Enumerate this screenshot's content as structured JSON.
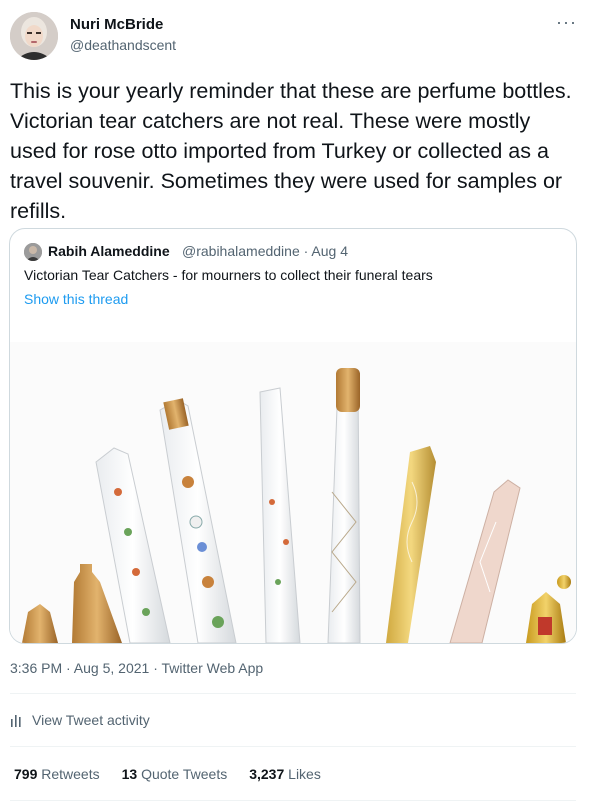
{
  "author": {
    "name": "Nuri McBride",
    "handle": "@deathandscent",
    "more_icon": "more-horizontal-icon"
  },
  "tweet": {
    "text": "This is your yearly reminder that these are perfume bottles. Victorian tear catchers are not real. These were mostly used for rose otto imported from Turkey or collected as a travel souvenir. Sometimes they were used for samples or refills."
  },
  "quote": {
    "name": "Rabih Alameddine",
    "meta": "@rabihalameddine · Aug 4",
    "text": "Victorian Tear Catchers - for mourners to collect their funeral tears",
    "link": "Show this thread"
  },
  "timestamp": "3:36 PM · Aug 5, 2021 · Twitter Web App",
  "activity": {
    "label": "View Tweet activity",
    "icon": "bar-chart-icon"
  },
  "stats": {
    "retweets_count": "799",
    "retweets_label": "Retweets",
    "quotes_count": "13",
    "quotes_label": "Quote Tweets",
    "likes_count": "3,237",
    "likes_label": "Likes"
  },
  "colors": {
    "link": "#1d9bf0",
    "secondary": "#536471",
    "border": "#cfd9de"
  }
}
